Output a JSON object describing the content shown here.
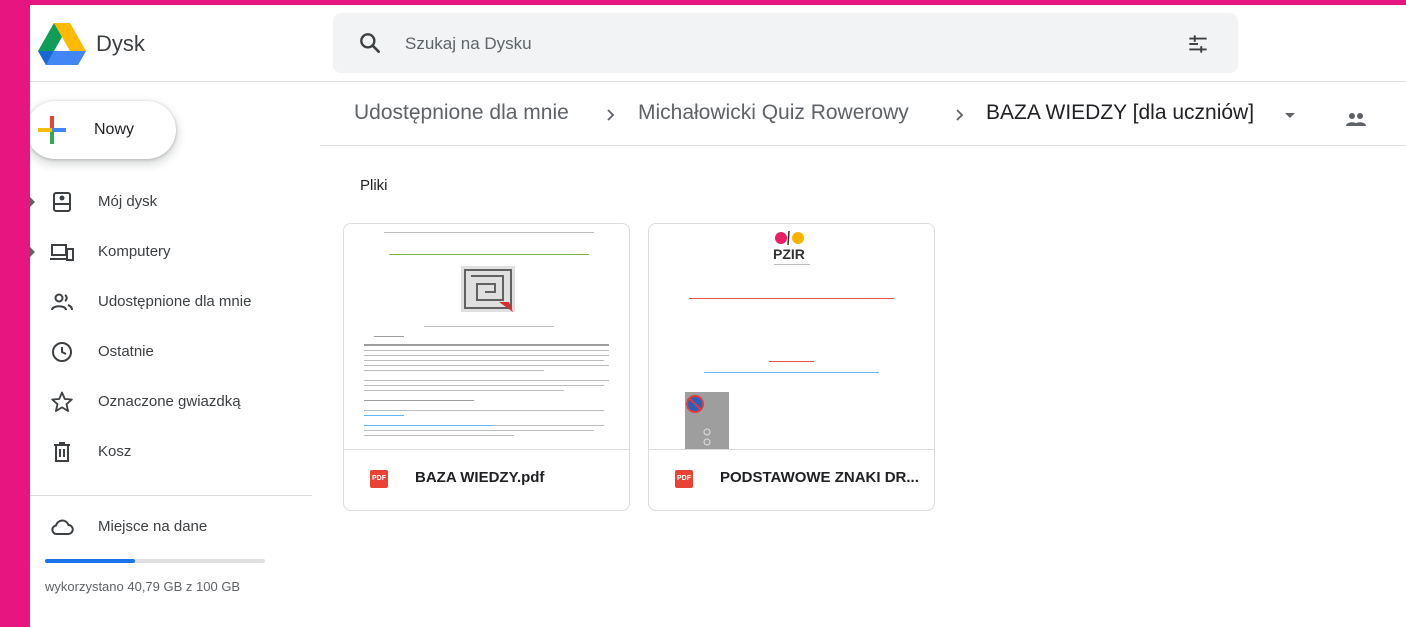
{
  "app": {
    "title": "Dysk"
  },
  "search": {
    "placeholder": "Szukaj na Dysku",
    "value": ""
  },
  "sidebar": {
    "new_label": "Nowy",
    "items": [
      {
        "label": "Mój dysk",
        "icon": "drive-icon"
      },
      {
        "label": "Komputery",
        "icon": "computer-icon"
      },
      {
        "label": "Udostępnione dla mnie",
        "icon": "shared-people-icon"
      },
      {
        "label": "Ostatnie",
        "icon": "clock-icon"
      },
      {
        "label": "Oznaczone gwiazdką",
        "icon": "star-icon"
      },
      {
        "label": "Kosz",
        "icon": "trash-icon"
      }
    ],
    "storage": {
      "label": "Miejsce na dane",
      "usage_text": "wykorzystano 40,79 GB z 100 GB",
      "used_fraction": 0.4079
    }
  },
  "breadcrumb": [
    {
      "label": "Udostępnione dla mnie"
    },
    {
      "label": "Michałowicki Quiz Rowerowy"
    },
    {
      "label": "BAZA WIEDZY [dla uczniów]"
    }
  ],
  "content": {
    "section_label": "Pliki",
    "files": [
      {
        "name": "BAZA WIEDZY.pdf",
        "type_badge": "PDF"
      },
      {
        "name": "PODSTAWOWE ZNAKI DR...",
        "type_badge": "PDF"
      }
    ]
  },
  "thumbnail2": {
    "logo_text": "PZIR"
  },
  "colors": {
    "frame": "#e6157f",
    "accent_blue": "#1a73e8",
    "pdf_red": "#ea4335"
  }
}
